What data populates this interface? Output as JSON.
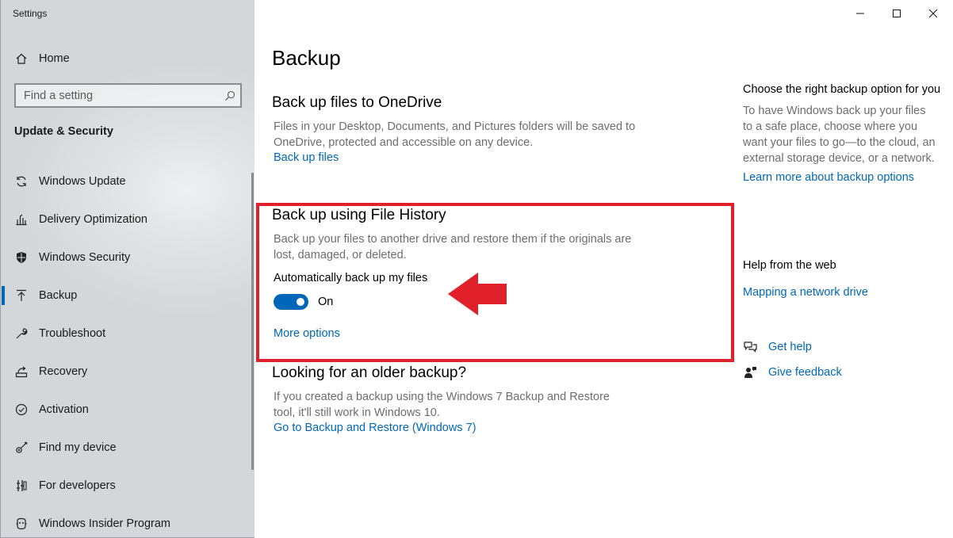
{
  "window": {
    "title": "Settings"
  },
  "sidebar": {
    "home_label": "Home",
    "search_placeholder": "Find a setting",
    "section_title": "Update & Security",
    "items": [
      {
        "label": "Windows Update",
        "icon": "refresh-icon"
      },
      {
        "label": "Delivery Optimization",
        "icon": "delivery-optimization-icon"
      },
      {
        "label": "Windows Security",
        "icon": "shield-icon"
      },
      {
        "label": "Backup",
        "icon": "backup-icon",
        "selected": true
      },
      {
        "label": "Troubleshoot",
        "icon": "wrench-icon"
      },
      {
        "label": "Recovery",
        "icon": "recovery-icon"
      },
      {
        "label": "Activation",
        "icon": "check-circle-icon"
      },
      {
        "label": "Find my device",
        "icon": "find-device-icon"
      },
      {
        "label": "For developers",
        "icon": "developer-icon"
      },
      {
        "label": "Windows Insider Program",
        "icon": "insider-icon"
      }
    ]
  },
  "main": {
    "title": "Backup",
    "onedrive": {
      "title": "Back up files to OneDrive",
      "desc": "Files in your Desktop, Documents, and Pictures folders will be saved to OneDrive, protected and accessible on any device.",
      "link": "Back up files"
    },
    "file_history": {
      "title": "Back up using File History",
      "desc": "Back up your files to another drive and restore them if the originals are lost, damaged, or deleted.",
      "toggle_label": "Automatically back up my files",
      "toggle_state": "On",
      "link": "More options"
    },
    "older": {
      "title": "Looking for an older backup?",
      "desc": "If you created a backup using the Windows 7 Backup and Restore tool, it'll still work in Windows 10.",
      "link": "Go to Backup and Restore (Windows 7)"
    }
  },
  "aside": {
    "choose_title": "Choose the right backup option for you",
    "choose_desc": "To have Windows back up your files to a safe place, choose where you want your files to go—to the cloud, an external storage device, or a network.",
    "learn_link": "Learn more about backup options",
    "web_title": "Help from the web",
    "web_link": "Mapping a network drive",
    "get_help": "Get help",
    "give_feedback": "Give feedback"
  },
  "colors": {
    "accent": "#0067b8",
    "highlight": "#e0202a"
  }
}
